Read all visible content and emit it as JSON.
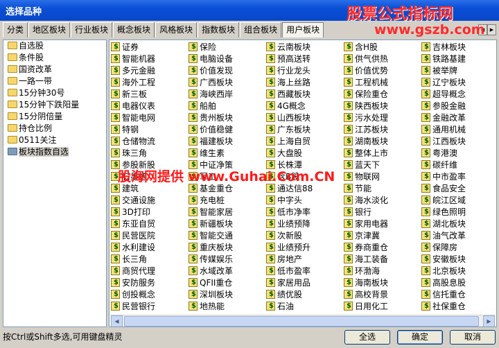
{
  "window": {
    "title": "选择品种"
  },
  "watermarks": {
    "top": "股票公式指标网",
    "sub": "www.gszb.com",
    "mid": "股海网提供 www.Guhai.Com.CN"
  },
  "tabs": [
    "分类",
    "地区板块",
    "行业板块",
    "概念板块",
    "风格板块",
    "指数板块",
    "组合板块",
    "用户板块"
  ],
  "active_tab_index": 7,
  "groups": [
    "自选股",
    "条件股",
    "国资改革",
    "一路一带",
    "15分钟30号",
    "15分钟下跌阳量",
    "15分阴倍量",
    "持仓比例",
    "0511关注",
    "板块指数自选"
  ],
  "selected_group_index": 9,
  "stocks": [
    "证券",
    "智能机器",
    "多元金融",
    "海外工程",
    "新三板",
    "电器仪表",
    "智能电网",
    "特钢",
    "仓储物流",
    "珠三角",
    "参股新股",
    "石墨烯",
    "建筑",
    "交通设施",
    "3D打印",
    "东亚自贸",
    "民营医院",
    "水利建设",
    "长三角",
    "商贸代理",
    "安防服务",
    "创投概念",
    "民营银行",
    "保险",
    "电脑设备",
    "价值发现",
    "广西板块",
    "海峡西岸",
    "船舶",
    "贵州板块",
    "价值稳健",
    "福建板块",
    "维生素",
    "中证净策",
    "军工",
    "基金重仓",
    "充电桩",
    "智能家居",
    "新疆板块",
    "智能交通",
    "重庆板块",
    "传媒娱乐",
    "水域改革",
    "QFII重仓",
    "深圳板块",
    "地热能",
    "云南板块",
    "预高送转",
    "行业龙头",
    "海上丝路",
    "西藏板块",
    "4G概念",
    "山西板块",
    "广东板块",
    "上海自贸",
    "大盘股",
    "长株潭",
    "含B股",
    "通达信88",
    "中字头",
    "低市净率",
    "业绩预降",
    "次新股",
    "业绩预升",
    "房地产",
    "低市盈率",
    "家居用品",
    "绩优股",
    "石油",
    "含H股",
    "供气供热",
    "价值优势",
    "工程机械",
    "保险重仓",
    "陕西板块",
    "污水处理",
    "江苏板块",
    "湖南板块",
    "整体上市",
    "蓝天下",
    "物联网",
    "节能",
    "海水淡化",
    "银行",
    "家用电器",
    "京津冀",
    "券商重仓",
    "海工装备",
    "环渤海",
    "海南板块",
    "高校背景",
    "日用化工",
    "吉林板块",
    "铁路基建",
    "被举牌",
    "辽宁板块",
    "超导概念",
    "参股金融",
    "金融改革",
    "通用机械",
    "江西板块",
    "粤港澳",
    "碳纤维",
    "中市盈率",
    "食品安全",
    "皖江区域",
    "绿色照明",
    "湖北板块",
    "油气改革",
    "保障房",
    "安徽板块",
    "北京板块",
    "高股息股",
    "信托重仓",
    "社保重仓"
  ],
  "status": {
    "hint": "按Ctrl或Shift多选,可用键盘精灵"
  },
  "buttons": {
    "select_all": "全选",
    "ok": "确定",
    "cancel": "取消"
  }
}
